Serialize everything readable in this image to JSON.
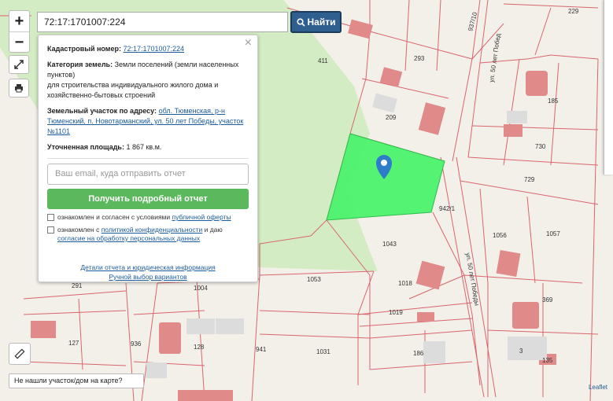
{
  "map": {
    "plots": [
      {
        "id": "p411",
        "label": "411"
      },
      {
        "id": "p293",
        "label": "293"
      },
      {
        "id": "p209",
        "label": "209"
      },
      {
        "id": "p730",
        "label": "730"
      },
      {
        "id": "p729",
        "label": "729"
      },
      {
        "id": "p185",
        "label": "185"
      },
      {
        "id": "p229",
        "label": "229"
      },
      {
        "id": "p1043",
        "label": "1043"
      },
      {
        "id": "p1053",
        "label": "1053"
      },
      {
        "id": "p1004",
        "label": "1004"
      },
      {
        "id": "p1018",
        "label": "1018"
      },
      {
        "id": "p1019",
        "label": "1019"
      },
      {
        "id": "p1056",
        "label": "1056"
      },
      {
        "id": "p1057",
        "label": "1057"
      },
      {
        "id": "p942",
        "label": "942/1"
      },
      {
        "id": "p369",
        "label": "369"
      },
      {
        "id": "p135",
        "label": "135"
      },
      {
        "id": "p3",
        "label": "3"
      },
      {
        "id": "p186",
        "label": "186"
      },
      {
        "id": "p1031",
        "label": "1031"
      },
      {
        "id": "p941",
        "label": "941"
      },
      {
        "id": "p128",
        "label": "128"
      },
      {
        "id": "p127",
        "label": "127"
      },
      {
        "id": "p936",
        "label": "936"
      },
      {
        "id": "p291",
        "label": "291"
      },
      {
        "id": "p937",
        "label": "937/10"
      }
    ],
    "streets": {
      "top": "ул. 50 лет Побед",
      "bottom": "ул. 50 лет Победы"
    }
  },
  "search": {
    "value": "72:17:1701007:224",
    "button_label": "Найти"
  },
  "zoom": {
    "in": "+",
    "out": "−"
  },
  "popup": {
    "cadastral_label": "Кадастровый номер:",
    "cadastral_value": "72:17:1701007:224",
    "category_label": "Категория земель:",
    "category_value": "Земли поселений (земли населенных пунктов)",
    "purpose": "для строительства индивидуального жилого дома и хозяйственно-бытовых строений",
    "address_label": "Земельный участок по адресу:",
    "address_value": "обл. Тюменская, р-н Тюменский, п. Новотарманский, ул. 50 лет Победы, участок №1101",
    "area_label": "Уточненная площадь:",
    "area_value": "1 867 кв.м.",
    "email_placeholder": "Ваш email, куда отправить отчет",
    "report_button": "Получить подробный отчет",
    "consent1_text": "ознакомлен и согласен с условиями ",
    "consent1_link": "публичной оферты",
    "consent2_text": "ознакомлен с ",
    "consent2_link": "политикой конфиденциальности",
    "consent2_text2": " и даю ",
    "consent2_link2": "согласие на обработку персональных данных",
    "details_link": "Детали отчета и юридическая информация",
    "manual_link": "Ручной выбор вариантов",
    "close": "×"
  },
  "not_found": "Не нашли участок/дом на карте?",
  "attribution": "Leaflet",
  "colors": {
    "selected_plot": "#4cf26e",
    "boundary": "#d9656c",
    "building": "#e08a8a",
    "pin": "#2f7dc9"
  }
}
